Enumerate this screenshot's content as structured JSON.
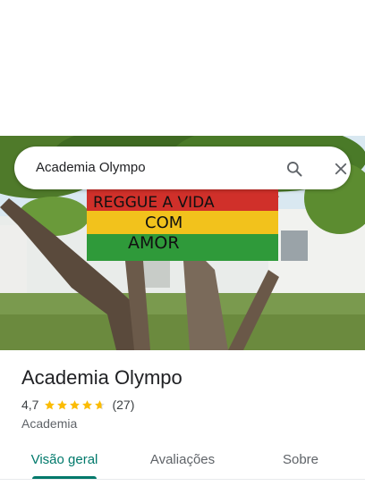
{
  "search": {
    "query": "Academia Olympo"
  },
  "photo": {
    "sign_lines": [
      "REGGUE A VIDA",
      "COM",
      "AMOR"
    ]
  },
  "place": {
    "name": "Academia Olympo",
    "rating": "4,7",
    "rating_value": 4.7,
    "review_count": "(27)",
    "category": "Academia"
  },
  "tabs": [
    {
      "label": "Visão geral",
      "selected": true
    },
    {
      "label": "Avaliações",
      "selected": false
    },
    {
      "label": "Sobre",
      "selected": false
    }
  ],
  "icons": {
    "search": "search-icon",
    "close": "close-icon",
    "star": "star-icon"
  },
  "colors": {
    "accent": "#00796b",
    "star": "#fbbc04",
    "text_primary": "#202124",
    "text_secondary": "#5f6368"
  }
}
